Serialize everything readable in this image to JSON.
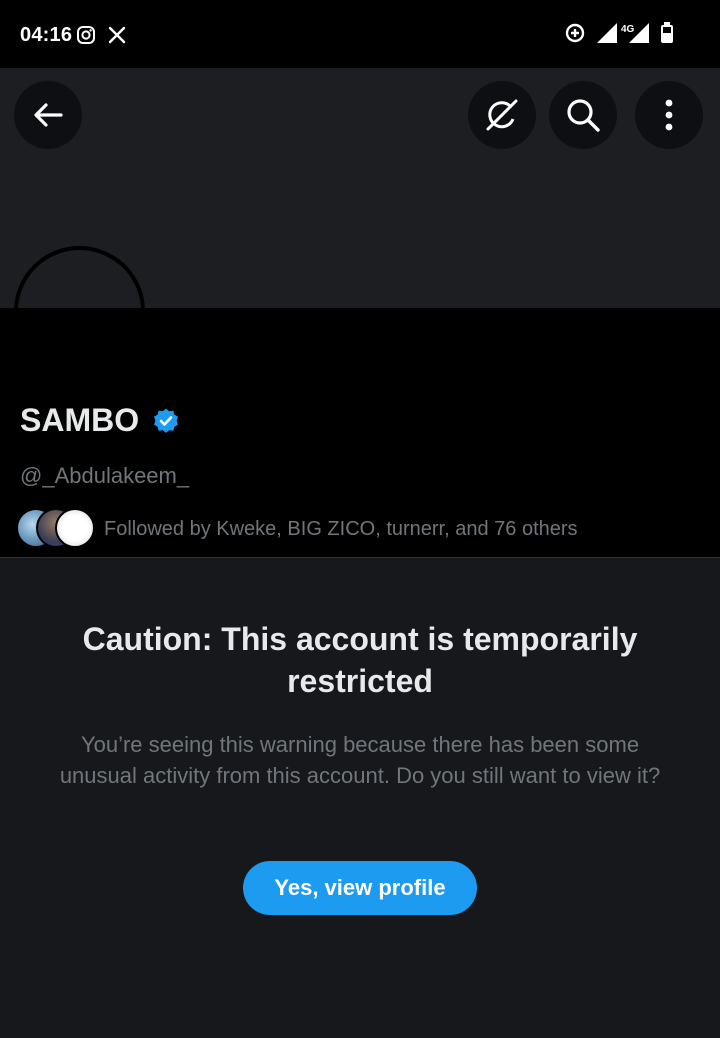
{
  "status_bar": {
    "time": "04:16",
    "network": "4G",
    "left_icons": [
      "instagram-icon",
      "x-icon"
    ],
    "right_icons": [
      "data-saver-icon",
      "signal-icon",
      "signal-4g-icon",
      "battery-icon"
    ]
  },
  "header": {
    "icons": [
      "back-arrow-icon",
      "grok-icon",
      "search-icon",
      "more-vertical-icon"
    ]
  },
  "profile": {
    "display_name": "SAMBO",
    "verified": true,
    "handle": "@_Abdulakeem_",
    "followed_by": "Followed by Kweke, BIG ZICO, turnerr, and 76 others"
  },
  "caution": {
    "title": "Caution: This account is temporarily restricted",
    "body": "You’re seeing this warning because there has been some unusual activity from this account. Do you still want to view it?",
    "button_label": "Yes, view profile"
  },
  "colors": {
    "accent": "#1d9bf0",
    "background": "#16181c",
    "secondary_text": "#71767b"
  }
}
